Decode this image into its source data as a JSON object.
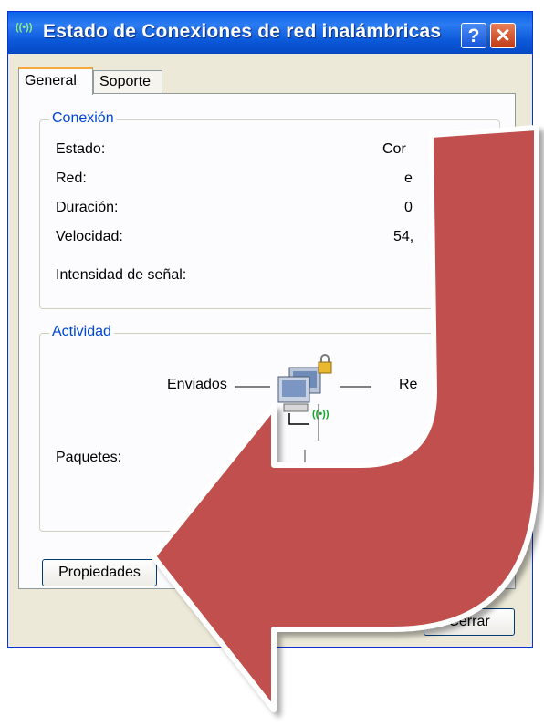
{
  "window": {
    "title": "Estado de Conexiones de red inalámbricas",
    "help_label": "?",
    "close_label": "✕",
    "title_icon_glyph": "((•))"
  },
  "tabs": [
    {
      "label": "General",
      "active": true
    },
    {
      "label": "Soporte",
      "active": false
    }
  ],
  "connection": {
    "legend": "Conexión",
    "rows": [
      {
        "label": "Estado:",
        "value": "Cor"
      },
      {
        "label": "Red:",
        "value": "e"
      },
      {
        "label": "Duración:",
        "value": "0"
      },
      {
        "label": "Velocidad:",
        "value": "54,"
      }
    ],
    "signal_label": "Intensidad de señal:"
  },
  "activity": {
    "legend": "Actividad",
    "sent_label": "Enviados",
    "received_label": "Re",
    "packets_label": "Paquetes:",
    "network_icon_glyph": "((•))"
  },
  "buttons": {
    "properties": "Propiedades",
    "close": "Cerrar"
  },
  "overlay": {
    "arrow_color": "#c0504d"
  }
}
